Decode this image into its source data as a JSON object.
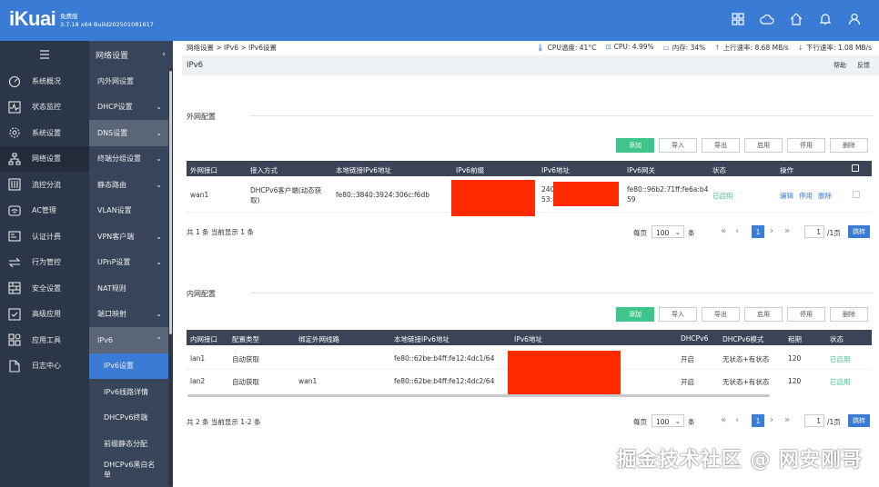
{
  "header": {
    "logo": "iKuai",
    "edition": "免费版",
    "build": "3.7.18 x64 Build202501081617"
  },
  "icons": [
    "grid-icon",
    "cloud-icon",
    "home-icon",
    "bell-icon",
    "user-icon"
  ],
  "sidebar": {
    "items": [
      {
        "label": "系统概况",
        "icon": "gauge-icon"
      },
      {
        "label": "状态监控",
        "icon": "pulse-icon"
      },
      {
        "label": "系统设置",
        "icon": "gear-icon"
      },
      {
        "label": "网络设置",
        "icon": "network-icon"
      },
      {
        "label": "流控分流",
        "icon": "sliders-icon"
      },
      {
        "label": "AC管理",
        "icon": "wifi-icon"
      },
      {
        "label": "认证计费",
        "icon": "idcard-icon"
      },
      {
        "label": "行为管控",
        "icon": "arrows-icon"
      },
      {
        "label": "安全设置",
        "icon": "firewall-icon"
      },
      {
        "label": "高级应用",
        "icon": "check-box-icon"
      },
      {
        "label": "应用工具",
        "icon": "apps-icon"
      },
      {
        "label": "日志中心",
        "icon": "doc-icon"
      }
    ]
  },
  "submenu": {
    "title": "网络设置",
    "items": [
      {
        "label": "内外网设置",
        "arrow": ""
      },
      {
        "label": "DHCP设置",
        "arrow": "⌄"
      },
      {
        "label": "DNS设置",
        "arrow": "⌄"
      },
      {
        "label": "终端分组设置",
        "arrow": "⌄"
      },
      {
        "label": "静态路由",
        "arrow": "⌄"
      },
      {
        "label": "VLAN设置",
        "arrow": ""
      },
      {
        "label": "VPN客户端",
        "arrow": "⌄"
      },
      {
        "label": "UPnP设置",
        "arrow": "⌄"
      },
      {
        "label": "NAT规则",
        "arrow": ""
      },
      {
        "label": "端口映射",
        "arrow": "⌄"
      },
      {
        "label": "IPv6",
        "arrow": "⌃"
      },
      {
        "label": "IPv6设置",
        "arrow": ""
      },
      {
        "label": "IPv6线路详情",
        "arrow": ""
      },
      {
        "label": "DHCPv6终端",
        "arrow": ""
      },
      {
        "label": "前缀静态分配",
        "arrow": ""
      },
      {
        "label": "DHCPv6黑白名单",
        "arrow": ""
      }
    ]
  },
  "breadcrumb": "网络设置 > IPv6 > IPv6设置",
  "stats": {
    "cpu_temp": "CPU温度: 41°C",
    "cpu": "CPU: 4.99%",
    "mem": "内存: 34%",
    "up": "上行速率: 8.68 MB/s",
    "down": "下行速率: 1.08 MB/s"
  },
  "page": {
    "title": "IPv6",
    "help": "帮助",
    "feedback": "反馈"
  },
  "wan": {
    "section_title": "外网配置",
    "buttons": [
      "添加",
      "导入",
      "导出",
      "启用",
      "停用",
      "删除"
    ],
    "headers": [
      "外网接口",
      "接入方式",
      "本地链接IPv6地址",
      "IPv6前缀",
      "IPv6地址",
      "IPv6网关",
      "状态",
      "操作"
    ],
    "row": {
      "iface": "wan1",
      "mode_line1": "DHCPv6客户端(动态获",
      "mode_line2": "取)",
      "local": "fe80::3840:3924:306c:f6db",
      "addr_line1": "240",
      "addr_line2": "53:8",
      "gw_line1": "fe80::96b2:71ff:fe6a:b4",
      "gw_line2": "59",
      "status": "已启用",
      "ops": [
        "编辑",
        "停用",
        "删除"
      ]
    },
    "summary": "共 1 条 当前显示 1 条"
  },
  "lan": {
    "section_title": "内网配置",
    "buttons": [
      "添加",
      "导入",
      "导出",
      "启用",
      "停用",
      "删除"
    ],
    "headers": [
      "内网接口",
      "配置类型",
      "绑定外网线路",
      "本地链接IPv6地址",
      "IPv6地址",
      "DHCPv6",
      "DHCPv6模式",
      "租期",
      "状态"
    ],
    "rows": [
      {
        "iface": "lan1",
        "type": "自动获取",
        "bind": "",
        "local": "fe80::62be:b4ff:fe12:4dc1/64",
        "dhcp": "开启",
        "mode": "无状态+有状态",
        "lease": "120",
        "status": "已启用"
      },
      {
        "iface": "lan2",
        "type": "自动获取",
        "bind": "wan1",
        "local": "fe80::62be:b4ff:fe12:4dc2/64",
        "dhcp": "开启",
        "mode": "无状态+有状态",
        "lease": "120",
        "status": "已启用"
      }
    ],
    "summary": "共 2 条 当前显示 1-2 条"
  },
  "pager": {
    "per_page": "每页",
    "size": "100",
    "unit": "条",
    "page": "1",
    "input": "1",
    "total": "/1页",
    "jump": "跳转"
  },
  "watermark": "掘金技术社区 @ 网安刚哥",
  "colors": {
    "brand": "#3a7bd5",
    "green": "#3ec58b",
    "sidebar": "#2b3648",
    "redaction": "#ff2a00"
  }
}
